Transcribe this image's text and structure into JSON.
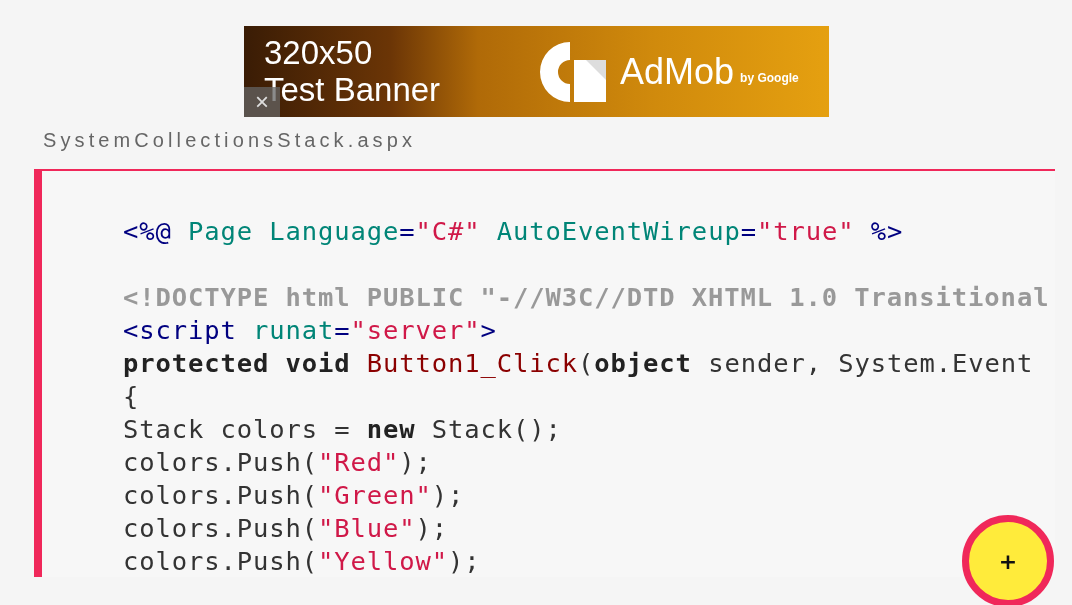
{
  "ad_banner": {
    "size_text": "320x50",
    "title": "Test Banner",
    "brand": "AdMob",
    "brand_suffix": "by Google",
    "close": "×"
  },
  "file_name": "SystemCollectionsStack.aspx",
  "code": {
    "lines": [
      {
        "kind": "code",
        "tokens": [
          {
            "kind": "tag",
            "text": "<%@"
          },
          {
            "kind": "attr",
            "text": " Page Language"
          },
          {
            "kind": "tag",
            "text": "="
          },
          {
            "kind": "string",
            "text": "\"C#\""
          },
          {
            "kind": "attr",
            "text": " AutoEventWireup"
          },
          {
            "kind": "tag",
            "text": "="
          },
          {
            "kind": "string",
            "text": "\"true\""
          },
          {
            "kind": "tag",
            "text": " %>"
          }
        ]
      },
      {
        "kind": "blank"
      },
      {
        "kind": "code",
        "tokens": [
          {
            "kind": "doctype",
            "text": "<!DOCTYPE html PUBLIC \"-//W3C//DTD XHTML 1.0 Transitional"
          }
        ]
      },
      {
        "kind": "code",
        "tokens": [
          {
            "kind": "tag",
            "text": "<script"
          },
          {
            "kind": "attr",
            "text": " runat"
          },
          {
            "kind": "tag",
            "text": "="
          },
          {
            "kind": "string",
            "text": "\"server\""
          },
          {
            "kind": "tag",
            "text": ">"
          }
        ]
      },
      {
        "kind": "code",
        "tokens": [
          {
            "kind": "keyword",
            "text": "protected void"
          },
          {
            "kind": "func",
            "text": " Button1_Click"
          },
          {
            "kind": "plain",
            "text": "("
          },
          {
            "kind": "keyword",
            "text": "object"
          },
          {
            "kind": "plain",
            "text": " sender, System.Event"
          }
        ]
      },
      {
        "kind": "code",
        "tokens": [
          {
            "kind": "plain",
            "text": "{"
          }
        ]
      },
      {
        "kind": "code",
        "tokens": [
          {
            "kind": "plain",
            "text": "Stack colors = "
          },
          {
            "kind": "keyword",
            "text": "new"
          },
          {
            "kind": "plain",
            "text": " Stack();"
          }
        ]
      },
      {
        "kind": "code",
        "tokens": [
          {
            "kind": "plain",
            "text": "colors.Push("
          },
          {
            "kind": "string",
            "text": "\"Red\""
          },
          {
            "kind": "plain",
            "text": ");"
          }
        ]
      },
      {
        "kind": "code",
        "tokens": [
          {
            "kind": "plain",
            "text": "colors.Push("
          },
          {
            "kind": "string",
            "text": "\"Green\""
          },
          {
            "kind": "plain",
            "text": ");"
          }
        ]
      },
      {
        "kind": "code",
        "tokens": [
          {
            "kind": "plain",
            "text": "colors.Push("
          },
          {
            "kind": "string",
            "text": "\"Blue\""
          },
          {
            "kind": "plain",
            "text": ");"
          }
        ]
      },
      {
        "kind": "code",
        "tokens": [
          {
            "kind": "plain",
            "text": "colors.Push("
          },
          {
            "kind": "string",
            "text": "\"Yellow\""
          },
          {
            "kind": "plain",
            "text": ");"
          }
        ]
      }
    ]
  },
  "fab": {
    "label": "+"
  }
}
